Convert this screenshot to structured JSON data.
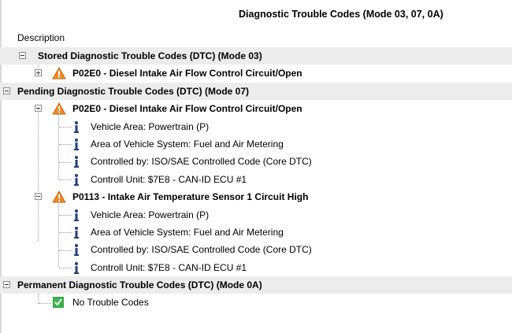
{
  "title": "Diagnostic Trouble Codes (Mode 03, 07, 0A)",
  "column_header": "Description",
  "groups": [
    {
      "label": "Stored Diagnostic Trouble Codes (DTC) (Mode 03)",
      "items": [
        {
          "code_label": "P02E0 - Diesel Intake Air Flow Control Circuit/Open",
          "expanded": false,
          "icon": "warning-triangle-icon",
          "details": []
        }
      ]
    },
    {
      "label": "Pending Diagnostic Trouble Codes (DTC) (Mode 07)",
      "items": [
        {
          "code_label": "P02E0 - Diesel Intake Air Flow Control Circuit/Open",
          "expanded": true,
          "icon": "warning-triangle-icon",
          "details": [
            "Vehicle Area: Powertrain (P)",
            "Area of Vehicle System: Fuel and Air Metering",
            "Controlled by: ISO/SAE Controlled Code (Core DTC)",
            "Controll Unit: $7E8 - CAN-ID ECU #1"
          ]
        },
        {
          "code_label": "P0113 - Intake Air Temperature Sensor 1 Circuit High",
          "expanded": true,
          "icon": "warning-triangle-icon",
          "details": [
            "Vehicle Area: Powertrain (P)",
            "Area of Vehicle System: Fuel and Air Metering",
            "Controlled by: ISO/SAE Controlled Code (Core DTC)",
            "Controll Unit: $7E8 - CAN-ID ECU #1"
          ]
        }
      ]
    },
    {
      "label": "Permanent Diagnostic Trouble Codes (DTC) (Mode 0A)",
      "no_codes": "No Trouble Codes"
    }
  ],
  "colors": {
    "group_row_bg": "#ececec",
    "warning_fill": "#f08a24",
    "warning_text": "#ffffff",
    "info_icon": "#1f3f7a",
    "ok_icon": "#3ab54a"
  }
}
